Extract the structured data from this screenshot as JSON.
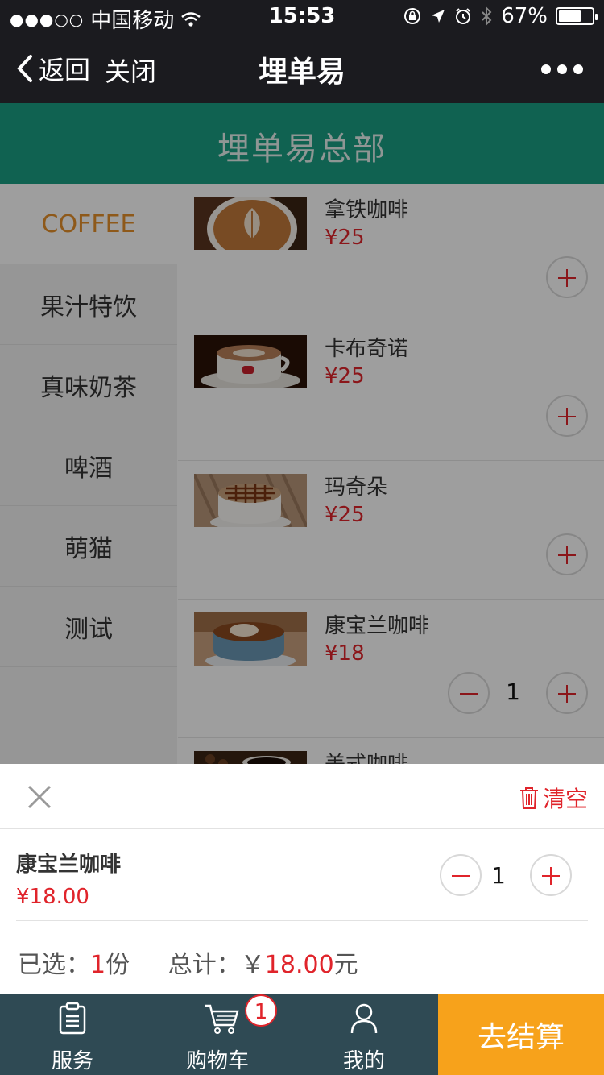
{
  "status_bar": {
    "signal_dots": "●●●○○",
    "carrier": "中国移动",
    "time": "15:53",
    "battery": "67%",
    "battery_level": 0.67
  },
  "navbar": {
    "back_label": "返回",
    "close_label": "关闭",
    "title": "埋单易"
  },
  "store": {
    "name": "埋单易总部"
  },
  "categories": [
    {
      "label": "COFFEE",
      "active": true
    },
    {
      "label": "果汁特饮",
      "active": false
    },
    {
      "label": "真味奶茶",
      "active": false
    },
    {
      "label": "啤酒",
      "active": false
    },
    {
      "label": "萌猫",
      "active": false
    },
    {
      "label": "测试",
      "active": false
    }
  ],
  "products": [
    {
      "name": "拿铁咖啡",
      "price": "¥25",
      "quantity": null,
      "image": "latte-image"
    },
    {
      "name": "卡布奇诺",
      "price": "¥25",
      "quantity": null,
      "image": "cappuccino-image"
    },
    {
      "name": "玛奇朵",
      "price": "¥25",
      "quantity": null,
      "image": "macchiato-image"
    },
    {
      "name": "康宝兰咖啡",
      "price": "¥18",
      "quantity": "1",
      "image": "con-panna-image"
    },
    {
      "name": "美式咖啡",
      "price": "",
      "quantity": null,
      "image": "americano-image"
    }
  ],
  "cart": {
    "clear_label": "清空",
    "item": {
      "name": "康宝兰咖啡",
      "price": "¥18.00",
      "quantity": "1"
    },
    "selected_prefix": "已选：",
    "selected_count": "1",
    "selected_unit": "份",
    "total_prefix": "总计：",
    "currency": "￥",
    "total": "18.00",
    "total_unit": "元"
  },
  "tabbar": {
    "service_label": "服务",
    "cart_label": "购物车",
    "cart_badge": "1",
    "mine_label": "我的",
    "checkout_label": "去结算"
  },
  "colors": {
    "store_header": "#1a9e84",
    "accent_orange": "#e5902b",
    "price_red": "#e0242b",
    "tabbar": "#2f4a54",
    "checkout": "#f7a21b"
  }
}
